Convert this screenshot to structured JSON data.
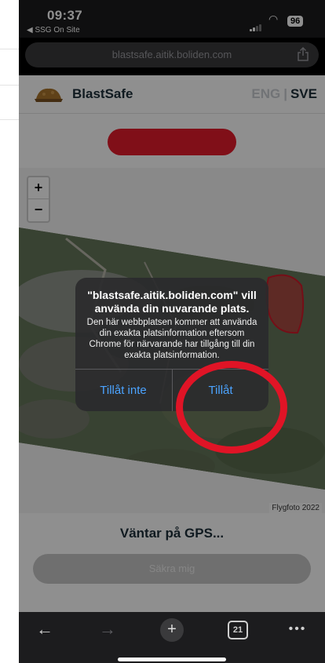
{
  "status_bar": {
    "time": "09:37",
    "back_app": "◀ SSG On Site",
    "battery": "96"
  },
  "browser": {
    "url": "blastsafe.aitik.boliden.com",
    "tab_count": "21"
  },
  "site": {
    "brand": "BlastSafe",
    "lang_eng": "ENG",
    "lang_sep": "|",
    "lang_sve": "SVE",
    "map_attribution": "Flygfoto 2022",
    "gps_status": "Väntar på GPS...",
    "secure_button": "Säkra mig"
  },
  "map_controls": {
    "zoom_in": "+",
    "zoom_out": "−"
  },
  "dialog": {
    "title": "\"blastsafe.aitik.boliden.com\" vill använda din nuvarande plats.",
    "message": "Den här webbplatsen kommer att använda din exakta platsinformation eftersom Chrome för närvarande har tillgång till din exakta platsinformation.",
    "deny": "Tillåt inte",
    "allow": "Tillåt"
  },
  "toolbar": {
    "back": "←",
    "forward": "→",
    "new_tab": "+",
    "more": "•••"
  },
  "colors": {
    "annotation_red": "#e01426",
    "ios_blue": "#4ba3ff",
    "brand_navy": "#1d2f3a"
  }
}
